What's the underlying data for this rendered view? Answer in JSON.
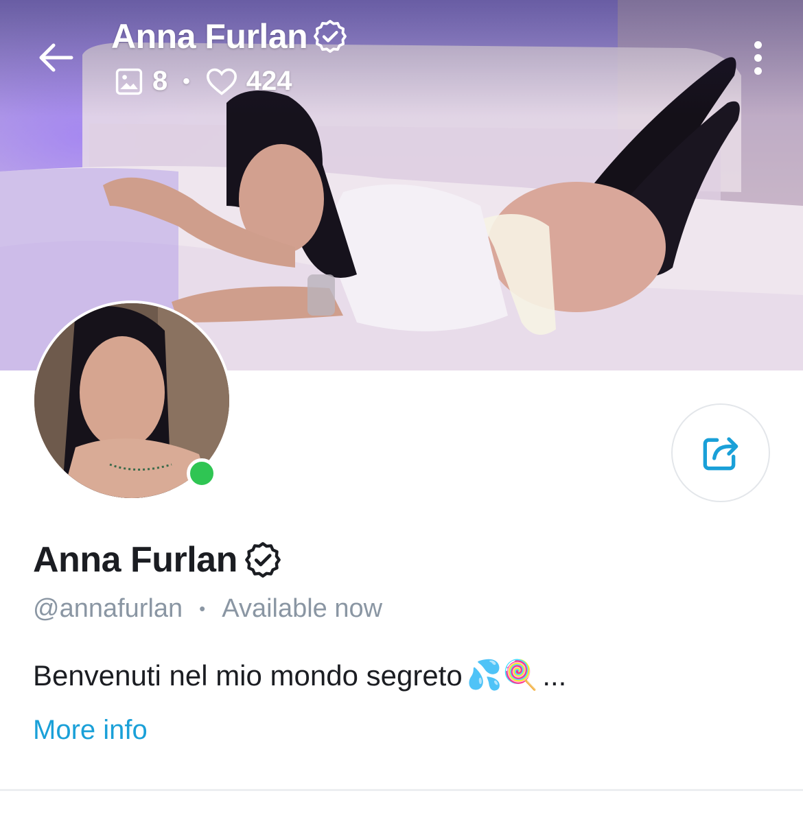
{
  "header": {
    "title": "Anna Furlan",
    "media_count": "8",
    "likes_count": "424",
    "separator": "•"
  },
  "profile": {
    "name": "Anna Furlan",
    "handle": "@annafurlan",
    "separator": "•",
    "status": "Available now",
    "bio": "Benvenuti nel mio mondo segreto",
    "bio_emojis": "💦🍭",
    "bio_ellipsis": "...",
    "more_info_label": "More info",
    "online": true
  },
  "icons": {
    "back": "arrow-left-icon",
    "verified": "verified-badge-icon",
    "media": "image-icon",
    "likes": "heart-icon",
    "more": "more-vertical-icon",
    "share": "share-icon"
  },
  "colors": {
    "accent": "#1aa0d8",
    "online": "#2fc553",
    "muted_text": "#8a96a3",
    "primary_text": "#1b1d22"
  }
}
